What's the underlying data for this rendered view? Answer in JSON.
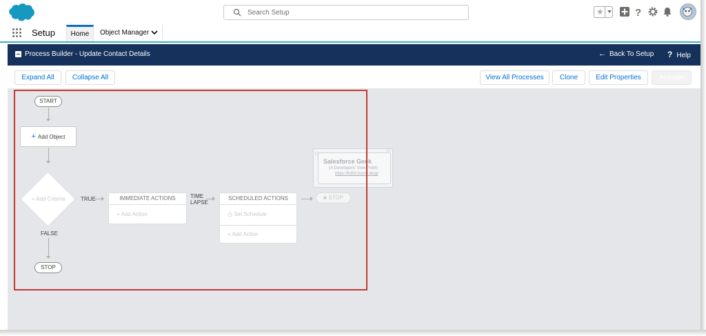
{
  "global_header": {
    "search_placeholder": "Search Setup",
    "icons": [
      "salesforce-cloud-logo",
      "search-icon",
      "favorites-star-icon",
      "add-icon",
      "help-icon",
      "setup-gear-icon",
      "notifications-bell-icon",
      "avatar"
    ]
  },
  "app_bar": {
    "app_name": "Setup",
    "tabs": [
      {
        "label": "Home",
        "active": true
      },
      {
        "label": "Object Manager",
        "active": false
      }
    ]
  },
  "pb_header": {
    "title": "Process Builder - Update Contact Details",
    "back_label": "Back To Setup",
    "help_label": "Help"
  },
  "toolbar": {
    "expand_all": "Expand All",
    "collapse_all": "Collapse All",
    "view_all_processes": "View All Processes",
    "clone": "Clone",
    "edit_properties": "Edit Properties",
    "activate": "Activate"
  },
  "canvas": {
    "start": "START",
    "add_object": "Add Object",
    "add_criteria": "Add Criteria",
    "true_label": "TRUE",
    "false_label": "FALSE",
    "stop_bottom": "STOP",
    "immediate_actions": "IMMEDIATE ACTIONS",
    "add_action_1": "Add Action",
    "time_lapse_1": "TIME",
    "time_lapse_2": "LAPSE",
    "scheduled_actions": "SCHEDULED ACTIONS",
    "set_schedule": "Set Schedule",
    "add_action_2": "Add Action",
    "stop_right": "STOP"
  },
  "watermark": {
    "title": "Salesforce Geek",
    "subtitle": "(A Developers' View Point)",
    "url": "https://6302.home.blog/"
  },
  "colors": {
    "brand_header": "#16325c",
    "accent_blue": "#0070d2",
    "selection_red": "#c23934",
    "canvas_bg": "#e4e6ea"
  }
}
